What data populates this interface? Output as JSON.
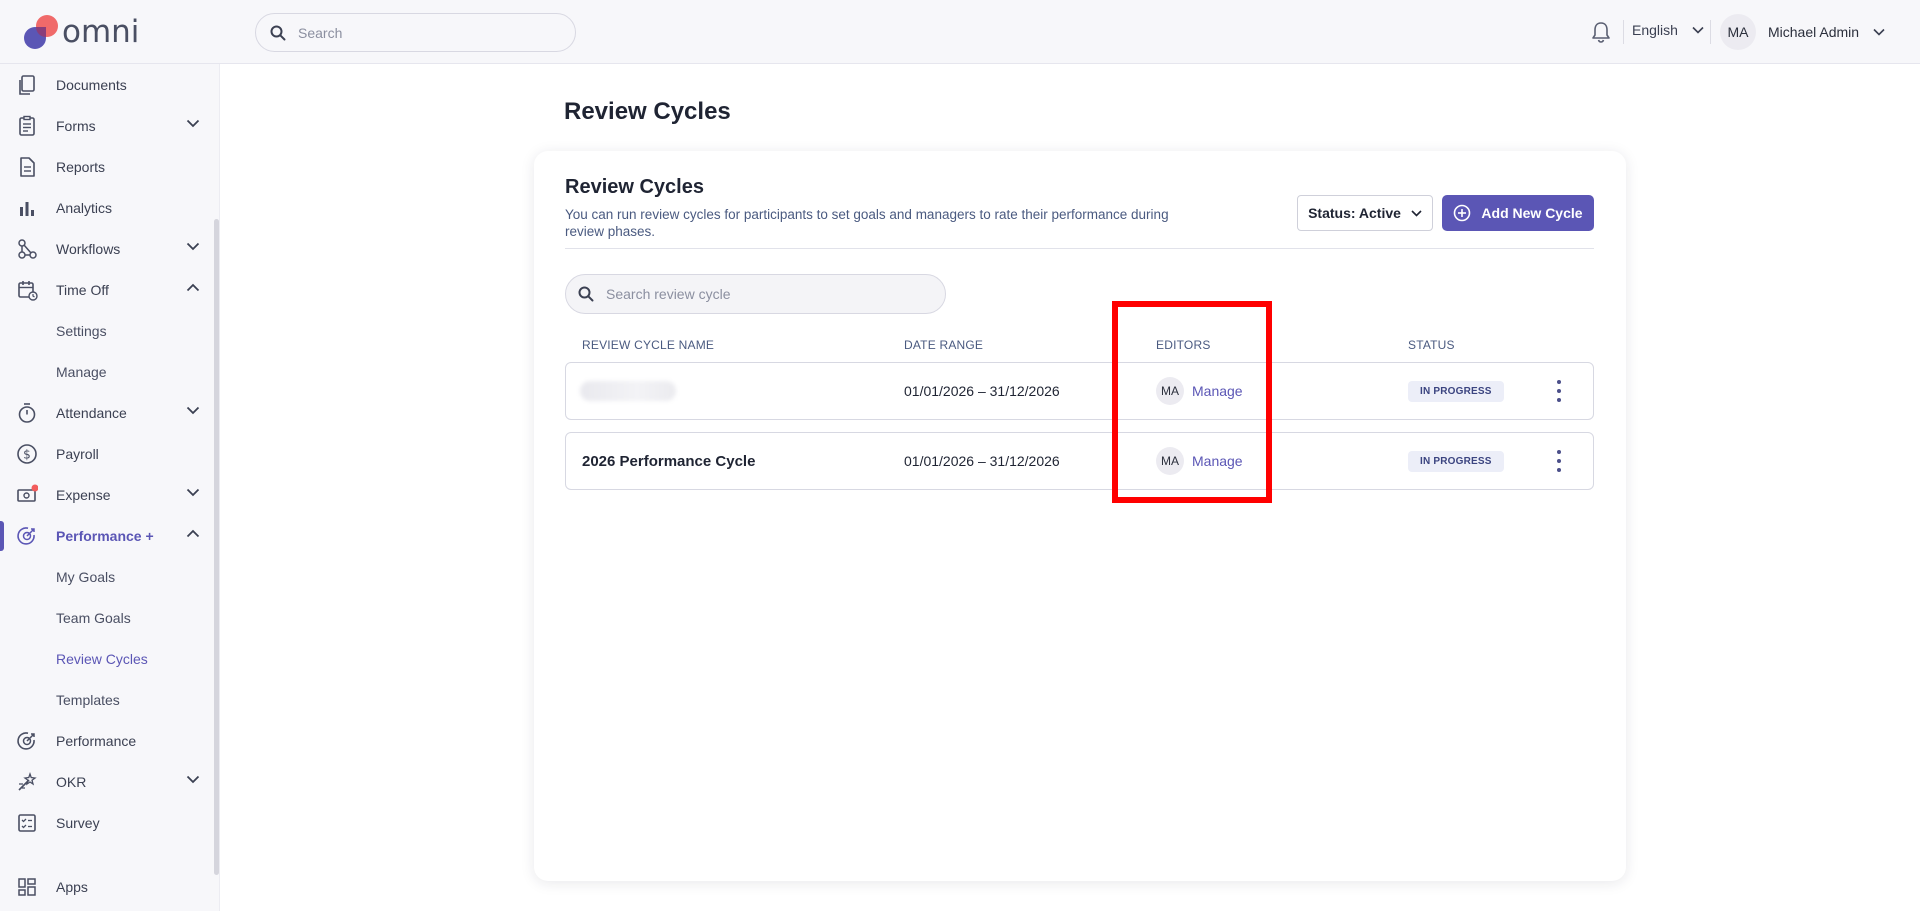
{
  "header": {
    "logo_text": "omni",
    "search_placeholder": "Search",
    "language": "English",
    "user_initials": "MA",
    "user_name": "Michael Admin"
  },
  "sidebar": {
    "items": [
      {
        "label": "Documents",
        "icon": "documents-icon"
      },
      {
        "label": "Forms",
        "icon": "forms-icon",
        "expand": "down"
      },
      {
        "label": "Reports",
        "icon": "reports-icon"
      },
      {
        "label": "Analytics",
        "icon": "analytics-icon"
      },
      {
        "label": "Workflows",
        "icon": "workflows-icon",
        "expand": "down"
      },
      {
        "label": "Time Off",
        "icon": "calendar-icon",
        "expand": "up"
      },
      {
        "label": "Settings",
        "sub": true
      },
      {
        "label": "Manage",
        "sub": true
      },
      {
        "label": "Attendance",
        "icon": "stopwatch-icon",
        "expand": "down"
      },
      {
        "label": "Payroll",
        "icon": "dollar-icon"
      },
      {
        "label": "Expense",
        "icon": "expense-icon",
        "expand": "down"
      },
      {
        "label": "Performance +",
        "icon": "performance-icon",
        "expand": "up",
        "active": true
      },
      {
        "label": "My Goals",
        "sub": true
      },
      {
        "label": "Team Goals",
        "sub": true
      },
      {
        "label": "Review Cycles",
        "sub": true,
        "active": true
      },
      {
        "label": "Templates",
        "sub": true
      },
      {
        "label": "Performance",
        "icon": "performance-icon"
      },
      {
        "label": "OKR",
        "icon": "okr-icon",
        "expand": "down"
      },
      {
        "label": "Survey",
        "icon": "survey-icon"
      },
      {
        "label": "Apps",
        "icon": "apps-icon"
      }
    ]
  },
  "main": {
    "page_title": "Review Cycles",
    "card_title": "Review Cycles",
    "card_description": "You can run review cycles for participants to set goals and managers to rate their performance during review phases.",
    "status_filter": "Status: Active",
    "add_button": "Add New Cycle",
    "search_placeholder": "Search review cycle",
    "columns": [
      "REVIEW CYCLE NAME",
      "DATE RANGE",
      "EDITORS",
      "STATUS"
    ],
    "rows": [
      {
        "name": "",
        "name_blurred": true,
        "date_range": "01/01/2026 – 31/12/2026",
        "editor_initials": "MA",
        "editor_action": "Manage",
        "status": "IN PROGRESS"
      },
      {
        "name": "2026 Performance Cycle",
        "name_blurred": false,
        "date_range": "01/01/2026 – 31/12/2026",
        "editor_initials": "MA",
        "editor_action": "Manage",
        "status": "IN PROGRESS"
      }
    ]
  },
  "colors": {
    "accent": "#5b56b5",
    "highlight": "#ff0000",
    "notification_dot": "#f25c5c"
  }
}
